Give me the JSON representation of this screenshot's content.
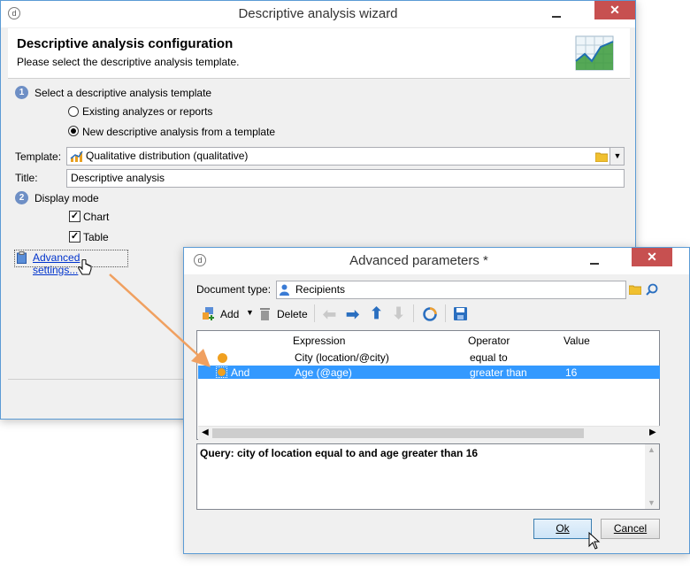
{
  "wizard": {
    "title": "Descriptive analysis wizard",
    "heading": "Descriptive analysis configuration",
    "subheading": "Please select the descriptive analysis template.",
    "step1_label": "Select a descriptive analysis template",
    "step1_num": "1",
    "radio_existing": "Existing analyzes or reports",
    "radio_new": "New descriptive analysis from a template",
    "radio_selected": "new",
    "template_label": "Template:",
    "template_value": "Qualitative distribution (qualitative)",
    "title_label": "Title:",
    "title_value": "Descriptive analysis",
    "step2_label": "Display mode",
    "step2_num": "2",
    "chart_label": "Chart",
    "chart_checked": true,
    "table_label": "Table",
    "table_checked": true,
    "advanced_link": "Advanced settings..."
  },
  "params": {
    "title": "Advanced parameters *",
    "doc_type_label": "Document type:",
    "doc_type_value": "Recipients",
    "toolbar": {
      "add_label": "Add",
      "delete_label": "Delete"
    },
    "columns": [
      "Expression",
      "Operator",
      "Value"
    ],
    "rows": [
      {
        "prefix": "",
        "expression": "City (location/@city)",
        "operator": "equal to",
        "value": "",
        "selected": false
      },
      {
        "prefix": "And",
        "expression": "Age (@age)",
        "operator": "greater than",
        "value": "16",
        "selected": true
      }
    ],
    "query_text": "Query: city of location equal to  and age greater than 16",
    "ok_label": "Ok",
    "cancel_label": "Cancel"
  },
  "colors": {
    "accent": "#3399ff",
    "border": "#5b9bd5",
    "close": "#c75050",
    "arrow": "#f0a060"
  }
}
